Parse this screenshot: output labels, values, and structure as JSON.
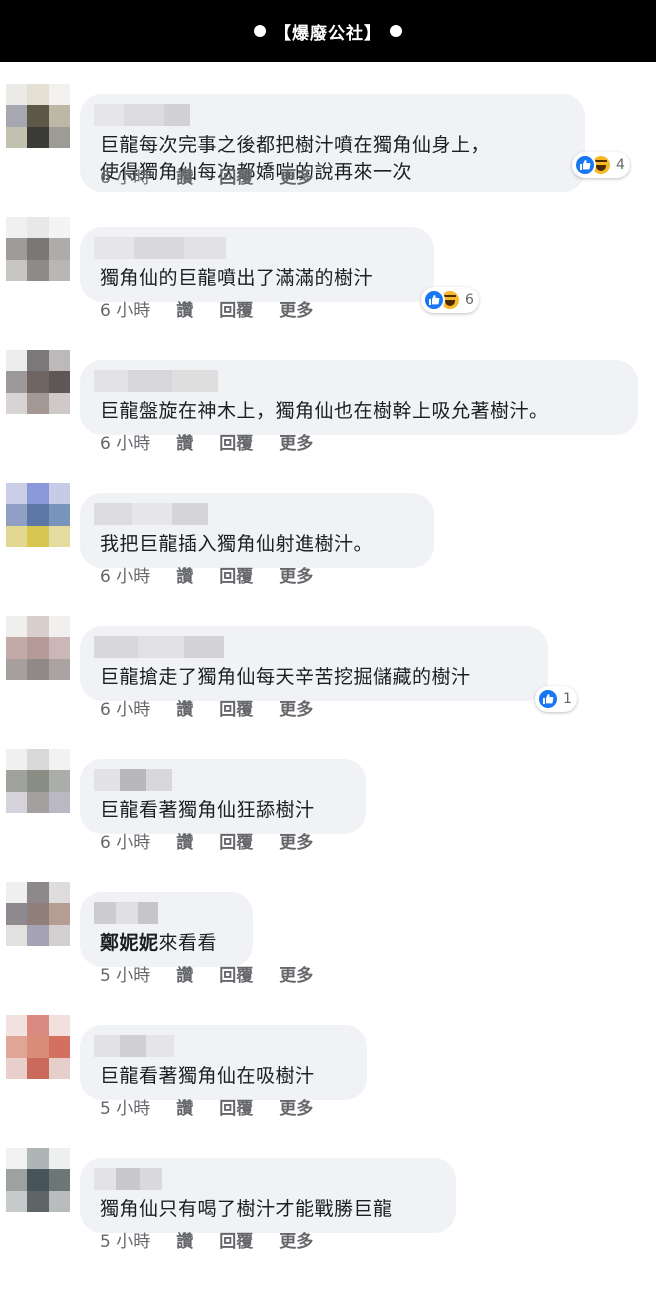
{
  "header": {
    "title": "【爆廢公社】"
  },
  "meta_labels": {
    "like": "讚",
    "reply": "回覆",
    "more": "更多"
  },
  "comments": [
    {
      "lines": [
        "巨龍每次完事之後都把樹汁噴在獨角仙身上，",
        "使得獨角仙每次都嬌喘的說再來一次"
      ],
      "time": "6 小時",
      "reaction_count": "4",
      "reactions": [
        "like-icon",
        "haha-icon"
      ]
    },
    {
      "lines": [
        "獨角仙的巨龍噴出了滿滿的樹汁"
      ],
      "time": "6 小時",
      "reaction_count": "6",
      "reactions": [
        "like-icon",
        "haha-icon"
      ]
    },
    {
      "lines": [
        "巨龍盤旋在神木上，獨角仙也在樹幹上吸允著樹汁。"
      ],
      "time": "6 小時"
    },
    {
      "lines": [
        "我把巨龍插入獨角仙射進樹汁。"
      ],
      "time": "6 小時"
    },
    {
      "lines": [
        "巨龍搶走了獨角仙每天辛苦挖掘儲藏的樹汁"
      ],
      "time": "6 小時",
      "reaction_count": "1",
      "reactions": [
        "like-icon"
      ]
    },
    {
      "lines": [
        "巨龍看著獨角仙狂舔樹汁"
      ],
      "time": "6 小時"
    },
    {
      "tag": "鄭妮妮",
      "lines": [
        "來看看"
      ],
      "time": "5 小時"
    },
    {
      "lines": [
        "巨龍看著獨角仙在吸樹汁"
      ],
      "time": "5 小時"
    },
    {
      "lines": [
        "獨角仙只有喝了樹汁才能戰勝巨龍"
      ],
      "time": "5 小時"
    }
  ],
  "colors": {
    "bubble": "#f0f2f5",
    "like": "#1877f2",
    "haha": "#f7b928",
    "meta": "#65676b"
  }
}
